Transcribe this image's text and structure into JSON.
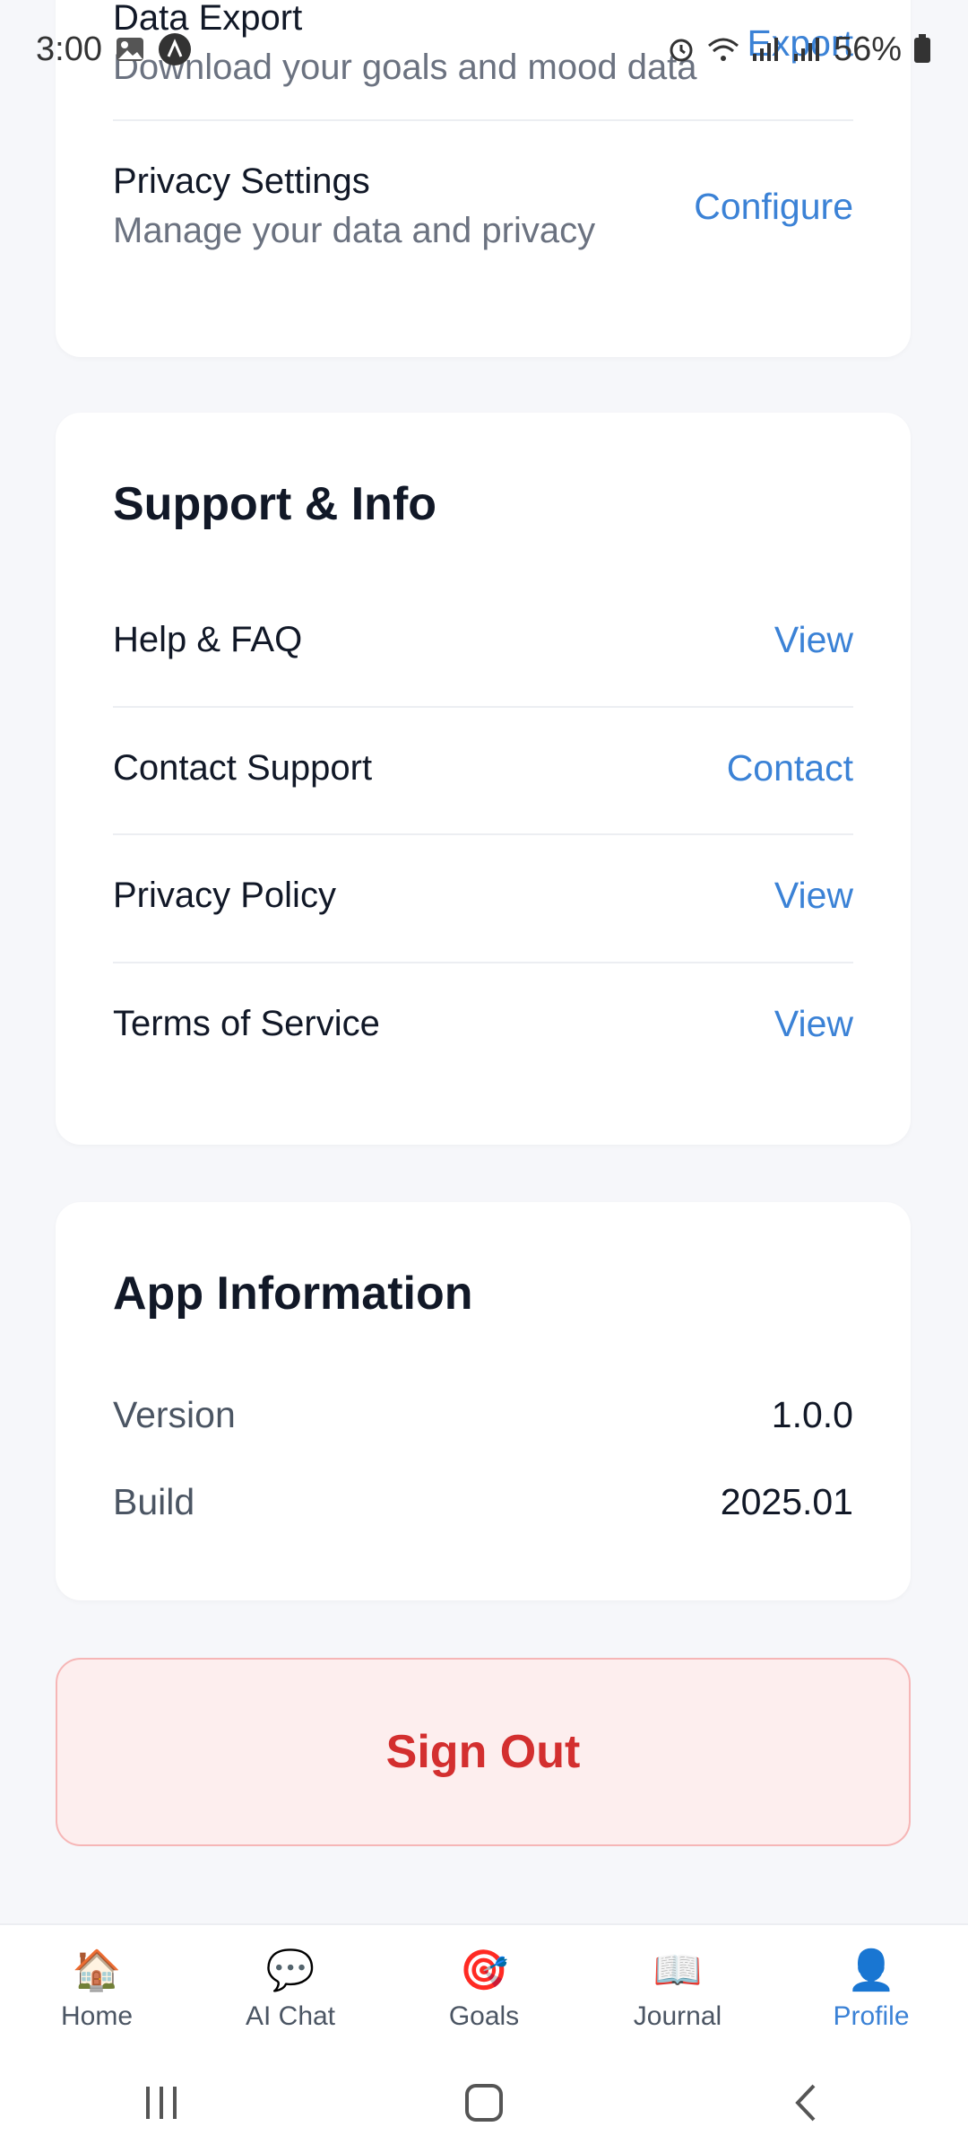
{
  "statusbar": {
    "time": "3:00",
    "battery": "56%",
    "icons": [
      "image-icon",
      "app-icon",
      "alarm-icon",
      "wifi-icon",
      "volte-icon",
      "signal-icon",
      "lte2-icon",
      "signal2-icon",
      "battery-icon"
    ]
  },
  "data_privacy": {
    "data_export": {
      "title": "Data Export",
      "subtitle": "Download your goals and mood data",
      "action": "Export"
    },
    "privacy_settings": {
      "title": "Privacy Settings",
      "subtitle": "Manage your data and privacy",
      "action": "Configure"
    }
  },
  "support": {
    "title": "Support & Info",
    "items": [
      {
        "label": "Help & FAQ",
        "action": "View"
      },
      {
        "label": "Contact Support",
        "action": "Contact"
      },
      {
        "label": "Privacy Policy",
        "action": "View"
      },
      {
        "label": "Terms of Service",
        "action": "View"
      }
    ]
  },
  "app_info": {
    "title": "App Information",
    "version_label": "Version",
    "version_value": "1.0.0",
    "build_label": "Build",
    "build_value": "2025.01"
  },
  "signout_label": "Sign Out",
  "bottom_nav": [
    {
      "label": "Home",
      "icon": "home-icon",
      "glyph": "🏠"
    },
    {
      "label": "AI Chat",
      "icon": "chat-icon",
      "glyph": "💬"
    },
    {
      "label": "Goals",
      "icon": "target-icon",
      "glyph": "🎯"
    },
    {
      "label": "Journal",
      "icon": "book-icon",
      "glyph": "📖"
    },
    {
      "label": "Profile",
      "icon": "profile-icon",
      "glyph": "👤"
    }
  ],
  "colors": {
    "accent": "#3b82d6",
    "danger": "#d32f2f",
    "danger_bg": "#fdeeee",
    "background": "#f6f7fa"
  }
}
